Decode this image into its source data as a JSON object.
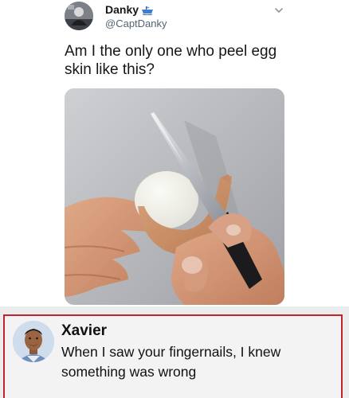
{
  "tweet": {
    "display_name": "Danky",
    "handle": "@CaptDanky",
    "text": "Am I the only one who peel egg skin like this?",
    "avatar_icon": "user-avatar-photo",
    "badge_icon": "flag-icon",
    "menu_icon": "chevron-down-icon",
    "media_description_icon": "photo-egg-knife"
  },
  "reply": {
    "name": "Xavier",
    "text": "When I saw your fingernails, I knew something was wrong",
    "avatar_icon": "user-avatar-photo",
    "border_color": "#c0242b"
  },
  "colors": {
    "name_text": "#14171a",
    "handle_text": "#536471",
    "reply_background": "#f3f3f4"
  }
}
